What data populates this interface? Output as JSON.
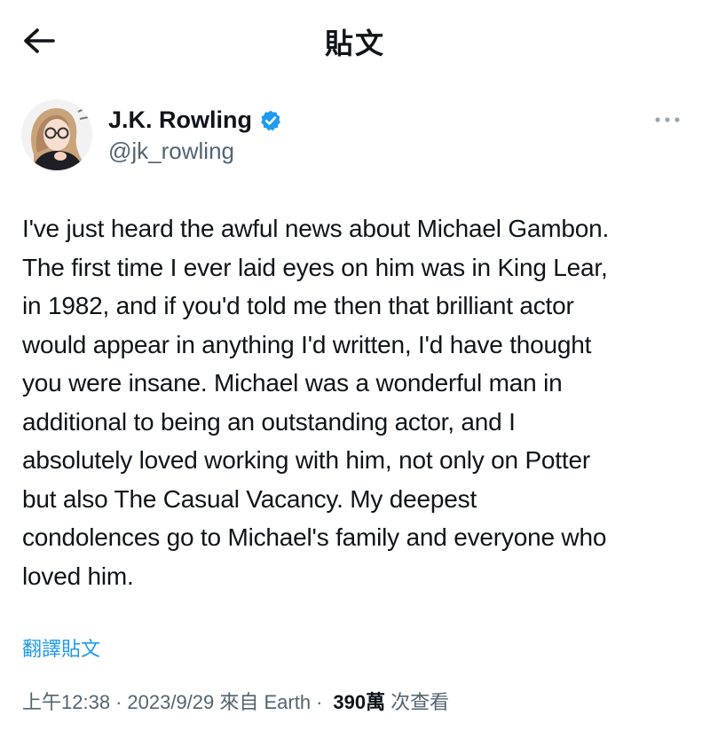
{
  "header": {
    "title": "貼文",
    "back_icon": "arrow-left-icon"
  },
  "author": {
    "name": "J.K. Rowling",
    "handle": "@jk_rowling",
    "verified": true,
    "verified_color": "#1d9bf0"
  },
  "tweet": {
    "text": "I've just heard the awful news about Michael Gambon.\nThe first time I ever laid eyes on him was in King Lear,\nin 1982, and if you'd told me then that brilliant actor\nwould appear in anything I'd written, I'd have thought\nyou were insane. Michael was a wonderful man in\nadditional to being an outstanding actor, and I\nabsolutely loved working with him, not only on Potter\nbut also The Casual Vacancy. My deepest\ncondolences go to Michael's family and everyone who\nloved him.",
    "translate_label": "翻譯貼文"
  },
  "meta": {
    "time": "上午12:38",
    "separator": "·",
    "date_source": "2023/9/29 來自 Earth",
    "views_count": "390萬",
    "views_label": "次查看"
  },
  "colors": {
    "accent": "#1d9bf0",
    "secondary_text": "#536471",
    "primary_text": "#0f1419"
  }
}
